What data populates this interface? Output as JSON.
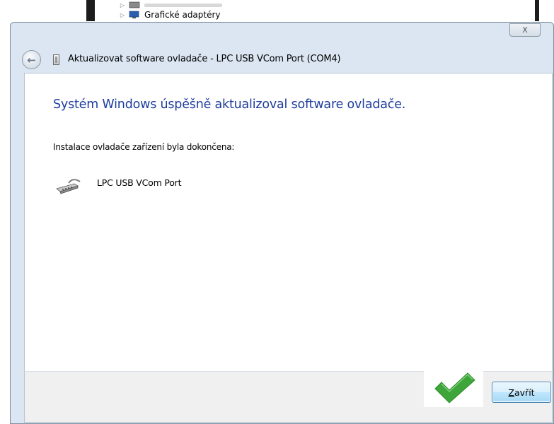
{
  "background_tree": {
    "items": [
      {
        "label": ""
      },
      {
        "label": "Grafické adaptéry"
      }
    ]
  },
  "dialog": {
    "close_glyph": "X",
    "back_glyph": "←",
    "title": "Aktualizovat software ovladače - LPC USB VCom Port (COM4)",
    "heading": "Systém Windows úspěšně aktualizoval software ovladače.",
    "subtext": "Instalace ovladače zařízení byla dokončena:",
    "device_name": "LPC USB VCom Port",
    "close_button_mnemonic": "Z",
    "close_button_rest": "avřít"
  },
  "colors": {
    "heading": "#1e3d9c",
    "check": "#3ea53a",
    "dialog_bg": "#dbe6f2"
  },
  "icons": {
    "back": "back-arrow-icon",
    "title": "device-icon",
    "device": "serial-port-icon",
    "success": "checkmark-icon",
    "display_adapter": "monitor-icon"
  }
}
